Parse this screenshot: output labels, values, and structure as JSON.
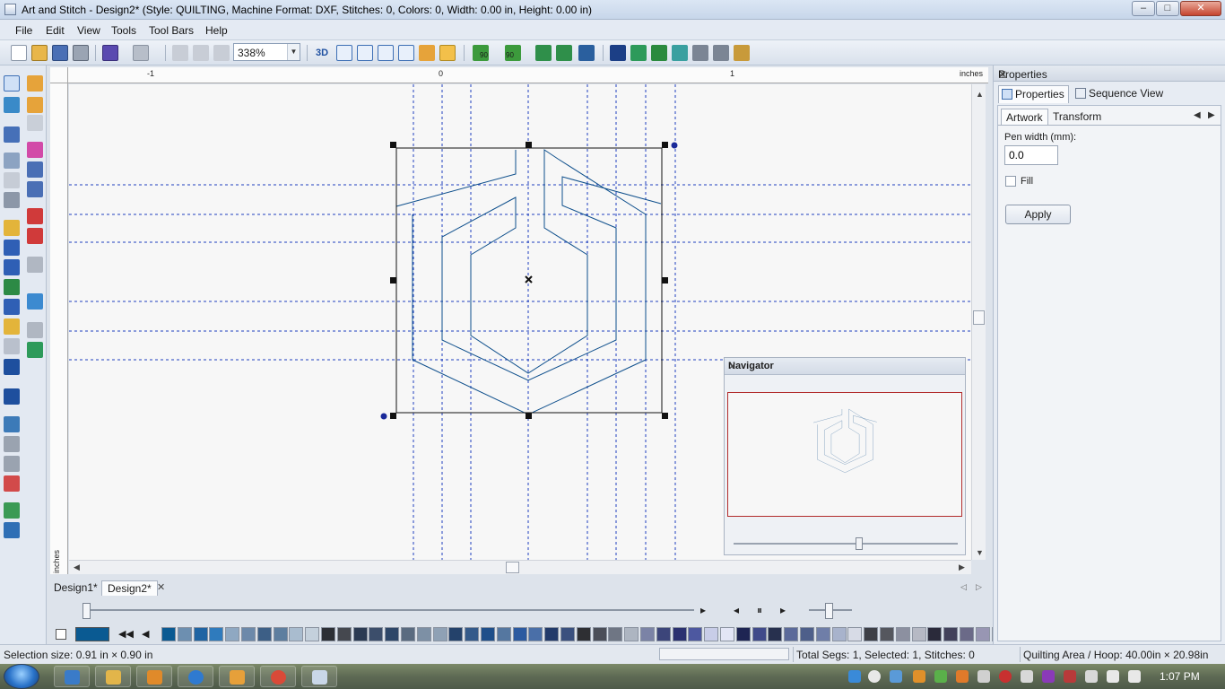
{
  "window": {
    "title": "Art and Stitch - Design2* (Style: QUILTING, Machine Format: DXF, Stitches: 0, Colors: 0, Width: 0.00 in, Height: 0.00 in)"
  },
  "menu": [
    "File",
    "Edit",
    "View",
    "Tools",
    "Tool Bars",
    "Help"
  ],
  "toolbar": {
    "zoom": "338%",
    "rotate_left_label": "90",
    "rotate_right_label": "90",
    "view_3d_label": "3D"
  },
  "ruler": {
    "top_labels": [
      "-1",
      "0",
      "1"
    ],
    "unit": "inches"
  },
  "navigator": {
    "title": "Navigator"
  },
  "doc_tabs": [
    "Design1*",
    "Design2*"
  ],
  "properties": {
    "title": "Properties",
    "tab_properties": "Properties",
    "tab_sequence": "Sequence View",
    "sub_artwork": "Artwork",
    "sub_transform": "Transform",
    "pen_width_label": "Pen width (mm):",
    "pen_width_value": "0.0",
    "fill_label": "Fill",
    "apply_label": "Apply"
  },
  "palette_colors": [
    "#0a5a92",
    "#6d8fb0",
    "#1f64a3",
    "#2f7bbd",
    "#8fa8c2",
    "#6c89aa",
    "#3d5f86",
    "#5e7e9f",
    "#a9bccf",
    "#c4d0dc",
    "#2c2f35",
    "#45484f",
    "#2b3a52",
    "#3c4e6b",
    "#2d4668",
    "#5a6b80",
    "#7d90a5",
    "#8fa1b5",
    "#24426b",
    "#345a8a",
    "#1f4f8a",
    "#5577a0",
    "#2c5aa0",
    "#4a6fa8",
    "#223a6a",
    "#3a507e",
    "#2e2f33",
    "#4b4e58",
    "#6f7684",
    "#adb5c1",
    "#7b83a6",
    "#3c457a",
    "#2b3170",
    "#4d58a0",
    "#c8cde8",
    "#e3e6f6",
    "#1e2553",
    "#404a8a",
    "#27304e",
    "#5b6a9a",
    "#4e5f8a",
    "#6f7ea8",
    "#a8b3cc",
    "#d7dbe6",
    "#3d3f46",
    "#55575e",
    "#8c90a0",
    "#b6b9c4",
    "#2a2a3a",
    "#42415a",
    "#6b6a88",
    "#9896b3",
    "#e6e6ee",
    "#f4f4f7",
    "#6a5f8a",
    "#8a7aa8",
    "#5a4d80",
    "#43386a",
    "#8a6fa3",
    "#b299c2",
    "#3e2f5a",
    "#5d447a",
    "#7d5a98",
    "#a57fb8"
  ],
  "status": {
    "selection_size": "Selection size: 0.91 in × 0.90 in",
    "totals": "Total Segs: 1, Selected: 1, Stitches: 0",
    "quilting_area": "Quilting Area / Hoop: 40.00in × 20.98in"
  },
  "taskbar": {
    "clock": "1:07 PM"
  },
  "colors": {
    "guide": "#1f3fbf",
    "design_stroke": "#0e4f8c",
    "navigator_border": "#b22c2c"
  }
}
